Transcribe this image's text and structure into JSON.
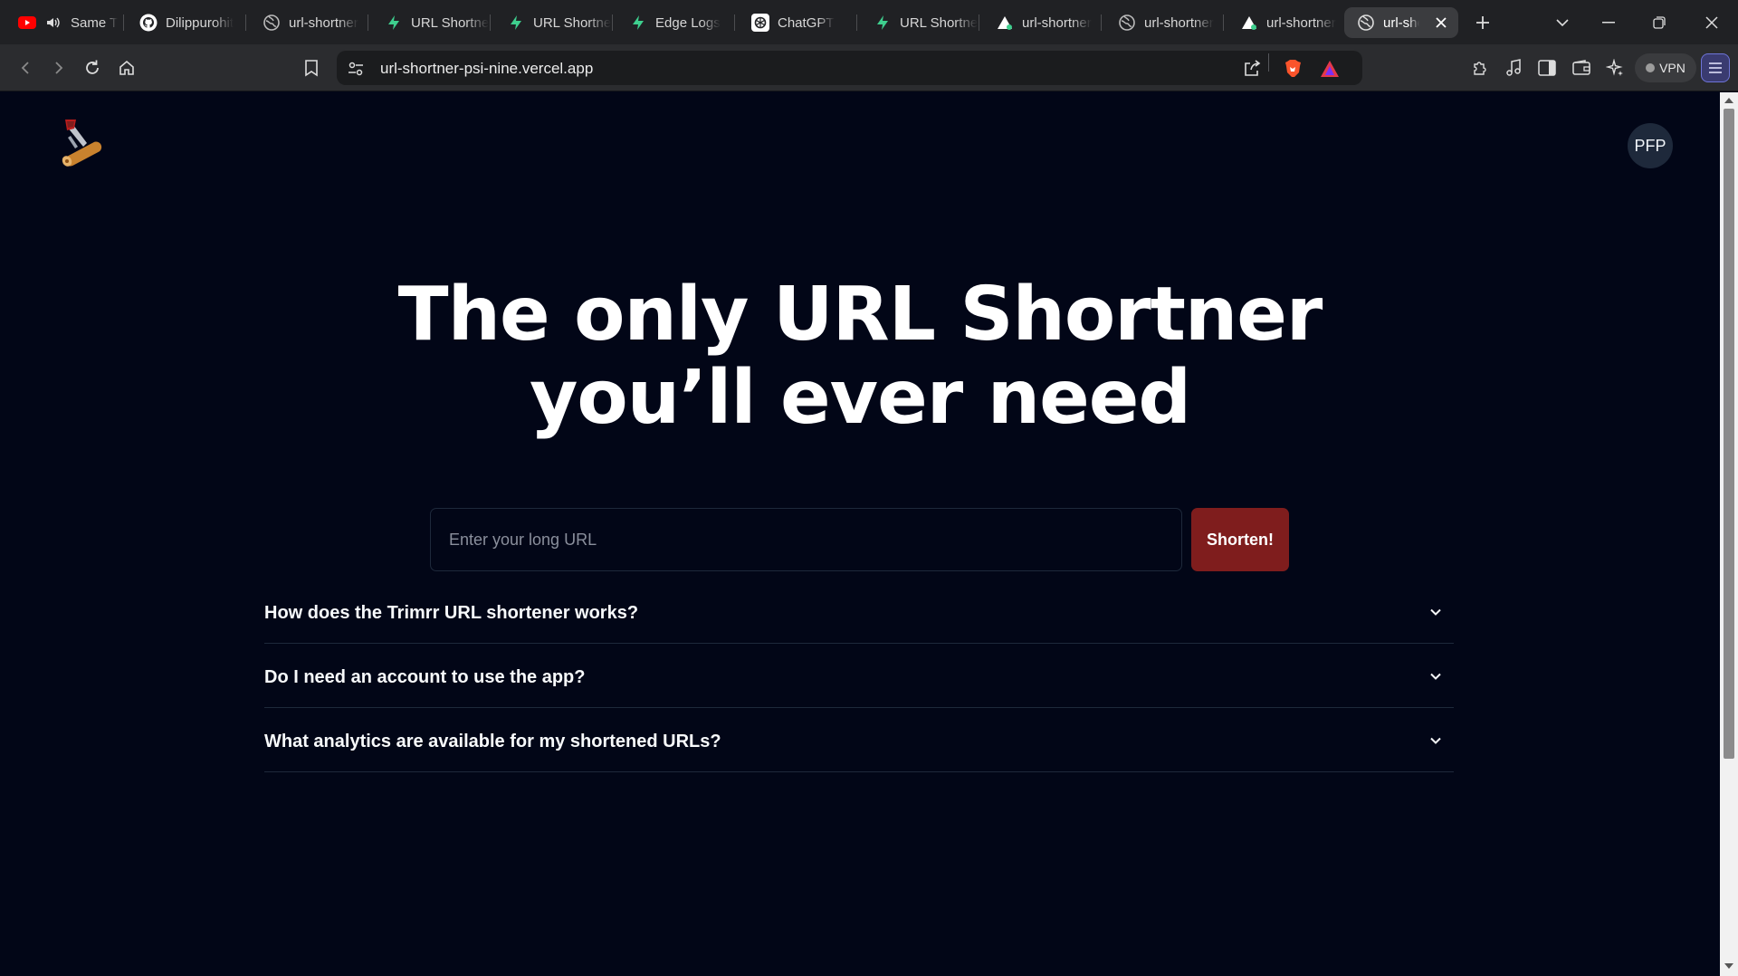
{
  "browser": {
    "tabs": [
      {
        "title": "Same T",
        "icon": "youtube-icon"
      },
      {
        "title": "Dilippurohit",
        "icon": "github-icon"
      },
      {
        "title": "url-shortner",
        "icon": "globe-icon"
      },
      {
        "title": "URL Shortner",
        "icon": "supabase-icon"
      },
      {
        "title": "URL Shortner",
        "icon": "supabase-icon"
      },
      {
        "title": "Edge Logs",
        "icon": "supabase-icon"
      },
      {
        "title": "ChatGPT",
        "icon": "chatgpt-icon"
      },
      {
        "title": "URL Shortner",
        "icon": "supabase-icon"
      },
      {
        "title": "url-shortner",
        "icon": "vercel-icon"
      },
      {
        "title": "url-shortner",
        "icon": "globe-icon"
      },
      {
        "title": "url-shortner",
        "icon": "vercel-icon"
      },
      {
        "title": "url-shortner",
        "icon": "globe-icon",
        "active": true
      }
    ],
    "address": "url-shortner-psi-nine.vercel.app",
    "vpn_label": "VPN",
    "colors": {
      "strip": "#202124",
      "toolbar": "#2b2c2f",
      "accent": "#6e74d8"
    }
  },
  "page": {
    "avatar_label": "PFP",
    "hero_line1": "The only URL Shortner",
    "hero_line2": "you’ll ever need",
    "input_placeholder": "Enter your long URL",
    "shorten_label": "Shorten!",
    "faq": [
      "How does the Trimrr URL shortener works?",
      "Do I need an account to use the app?",
      "What analytics are available for my shortened URLs?"
    ],
    "colors": {
      "background": "#020617",
      "button": "#7f1d1d",
      "border": "#1e293b"
    }
  }
}
